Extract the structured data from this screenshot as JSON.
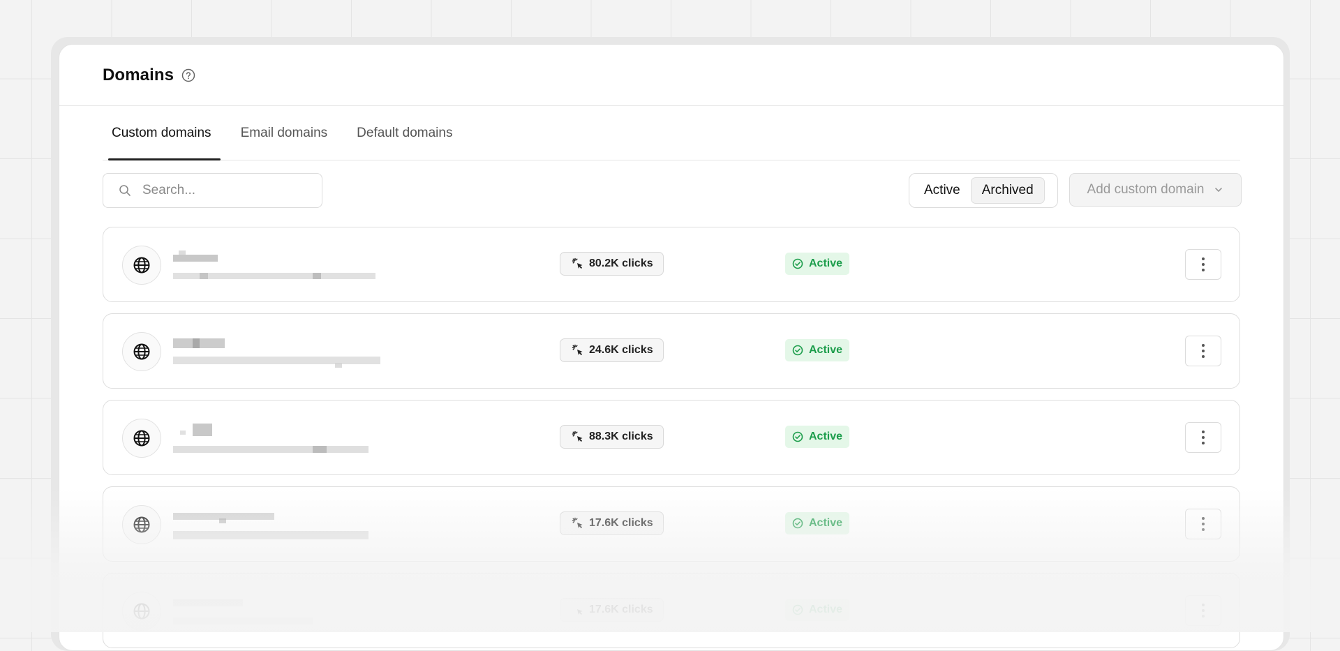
{
  "header": {
    "title": "Domains"
  },
  "tabs": [
    {
      "label": "Custom domains"
    },
    {
      "label": "Email domains"
    },
    {
      "label": "Default domains"
    }
  ],
  "search": {
    "placeholder": "Search..."
  },
  "filter": {
    "active_label": "Active",
    "archived_label": "Archived",
    "selected": "Archived"
  },
  "add_button": {
    "label": "Add custom domain"
  },
  "domains": [
    {
      "clicks": "80.2K clicks",
      "status": "Active"
    },
    {
      "clicks": "24.6K clicks",
      "status": "Active"
    },
    {
      "clicks": "88.3K clicks",
      "status": "Active"
    },
    {
      "clicks": "17.6K clicks",
      "status": "Active"
    },
    {
      "clicks": "17.6K clicks",
      "status": "Active"
    }
  ],
  "colors": {
    "status_green": "#1c9d4b",
    "status_bg": "#e4f7e8",
    "text_dark": "#111111"
  }
}
